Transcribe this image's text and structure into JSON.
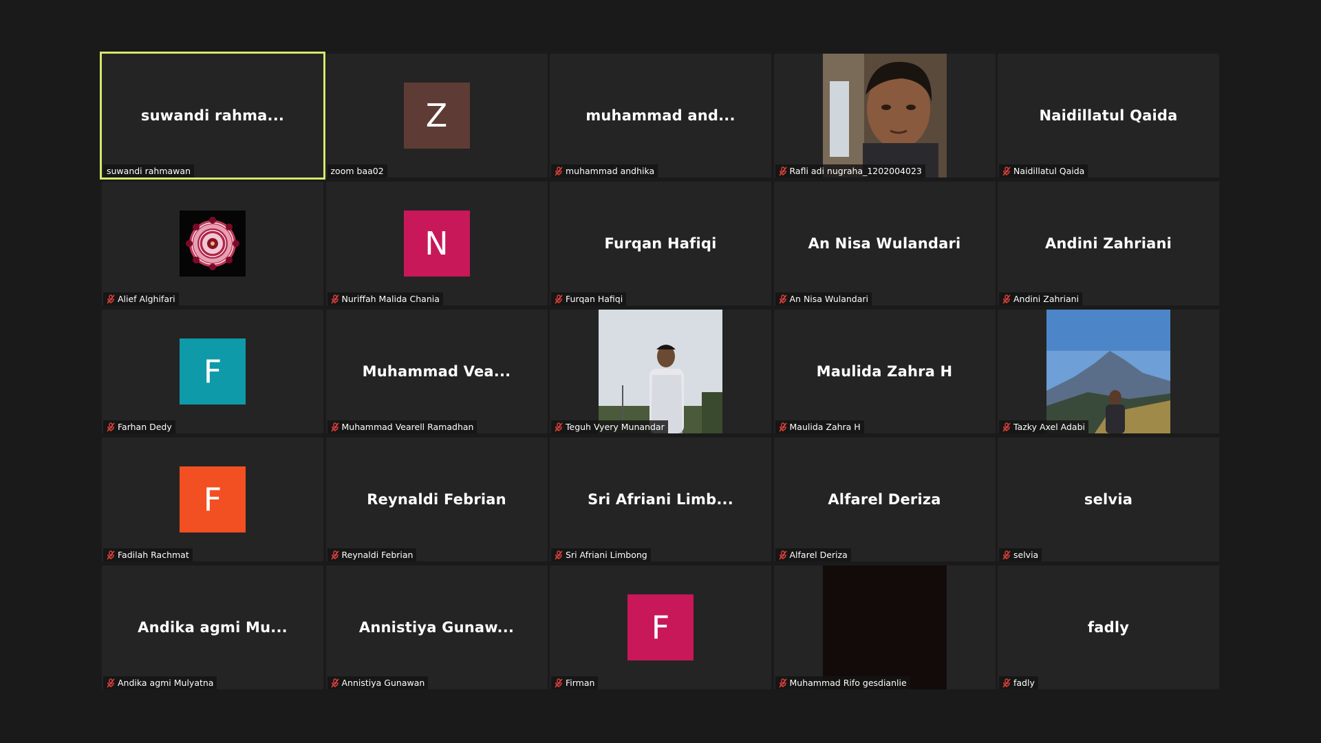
{
  "colors": {
    "background": "#1a1a1a",
    "tile": "#242424",
    "active_border": "#d8e86a",
    "mute_red": "#e0403a"
  },
  "participants": [
    {
      "display": "suwandi  rahma...",
      "name": "suwandi rahmawan",
      "muted": false,
      "active": true,
      "type": "text"
    },
    {
      "display": "Z",
      "name": "zoom baa02",
      "muted": false,
      "type": "avatar",
      "color": "#5e3c35"
    },
    {
      "display": "muhammad  and...",
      "name": "muhammad andhika",
      "muted": true,
      "type": "text"
    },
    {
      "display": "",
      "name": "Rafli adi nugraha_1202004023",
      "muted": true,
      "type": "photo",
      "photo": "portrait"
    },
    {
      "display": "Naidillatul Qaida",
      "name": "Naidillatul Qaida",
      "muted": true,
      "type": "text"
    },
    {
      "display": "",
      "name": "Alief Alghifari",
      "muted": true,
      "type": "photo-small",
      "photo": "mandala"
    },
    {
      "display": "N",
      "name": "Nuriffah Malida Chania",
      "muted": true,
      "type": "avatar",
      "color": "#c8185a"
    },
    {
      "display": "Furqan Hafiqi",
      "name": "Furqan Hafiqi",
      "muted": true,
      "type": "text"
    },
    {
      "display": "An Nisa Wulandari",
      "name": "An Nisa Wulandari",
      "muted": true,
      "type": "text"
    },
    {
      "display": "Andini Zahriani",
      "name": "Andini Zahriani",
      "muted": true,
      "type": "text"
    },
    {
      "display": "F",
      "name": "Farhan Dedy",
      "muted": true,
      "type": "avatar",
      "color": "#0f9aaa"
    },
    {
      "display": "Muhammad  Vea...",
      "name": "Muhammad Vearell Ramadhan",
      "muted": true,
      "type": "text"
    },
    {
      "display": "",
      "name": "Teguh Vyery Munandar",
      "muted": true,
      "type": "photo",
      "photo": "outdoor"
    },
    {
      "display": "Maulida Zahra H",
      "name": "Maulida Zahra H",
      "muted": true,
      "type": "text"
    },
    {
      "display": "",
      "name": "Tazky Axel Adabi",
      "muted": true,
      "type": "photo",
      "photo": "mountain"
    },
    {
      "display": "F",
      "name": "Fadilah Rachmat",
      "muted": true,
      "type": "avatar",
      "color": "#f25022"
    },
    {
      "display": "Reynaldi Febrian",
      "name": "Reynaldi Febrian",
      "muted": true,
      "type": "text"
    },
    {
      "display": "Sri  Afriani  Limb...",
      "name": "Sri Afriani Limbong",
      "muted": true,
      "type": "text"
    },
    {
      "display": "Alfarel Deriza",
      "name": "Alfarel Deriza",
      "muted": true,
      "type": "text"
    },
    {
      "display": "selvia",
      "name": "selvia",
      "muted": true,
      "type": "text"
    },
    {
      "display": "Andika  agmi  Mu...",
      "name": "Andika agmi Mulyatna",
      "muted": true,
      "type": "text"
    },
    {
      "display": "Annistiya  Gunaw...",
      "name": "Annistiya Gunawan",
      "muted": true,
      "type": "text"
    },
    {
      "display": "F",
      "name": "Firman",
      "muted": true,
      "type": "avatar",
      "color": "#c8185a"
    },
    {
      "display": "",
      "name": "Muhammad Rifo gesdianlie",
      "muted": true,
      "type": "photo",
      "photo": "dark"
    },
    {
      "display": "fadly",
      "name": "fadly",
      "muted": true,
      "type": "text"
    }
  ]
}
